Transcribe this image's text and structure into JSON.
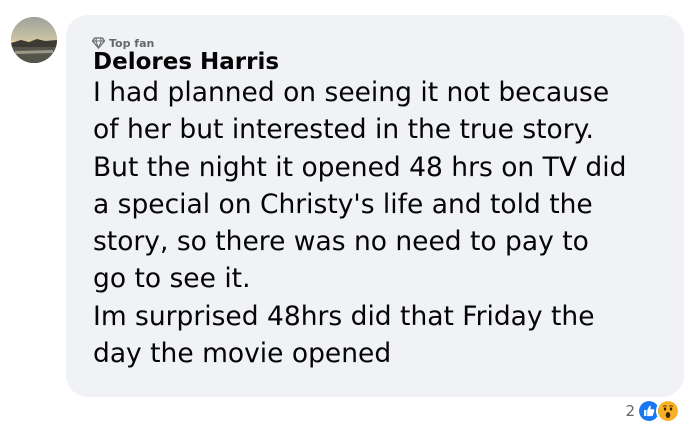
{
  "comment": {
    "badge_label": "Top fan",
    "badge_icon": "diamond-icon",
    "author": "Delores Harris",
    "text_lines": [
      "I had planned on seeing it not because",
      "of her but interested in the true story.",
      "But the night it opened 48 hrs on TV did",
      "a special on Christy's life and told the",
      "story, so there was no need to pay to",
      "go to see it.",
      "Im surprised 48hrs did that Friday the",
      "day the movie opened"
    ],
    "reactions": {
      "count": "2",
      "types": [
        "like-icon",
        "wow-icon"
      ]
    }
  },
  "colors": {
    "bubble_background": "#f0f2f5",
    "text_primary": "#050505",
    "text_secondary": "#65676b",
    "like_blue": "#1877f2",
    "wow_yellow": "#f7b125"
  }
}
